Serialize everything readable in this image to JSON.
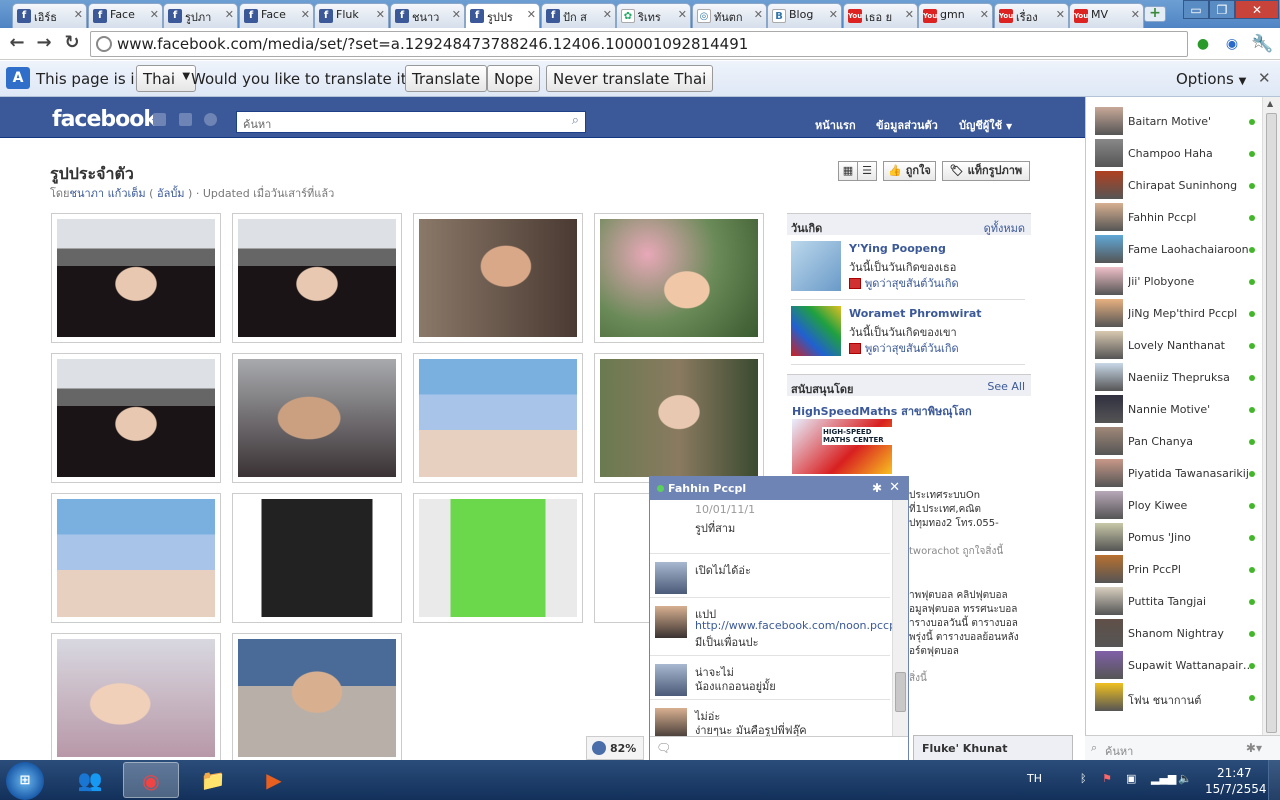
{
  "browser": {
    "tabs": [
      {
        "title": "เอิร์ธ",
        "icon": "f"
      },
      {
        "title": "Face",
        "icon": "f"
      },
      {
        "title": "รูปภา",
        "icon": "f"
      },
      {
        "title": "Face",
        "icon": "f"
      },
      {
        "title": "Fluk",
        "icon": "f"
      },
      {
        "title": "ชนาว",
        "icon": "f"
      },
      {
        "title": "รูปปร",
        "icon": "f",
        "active": true
      },
      {
        "title": "ปัก ส",
        "icon": "f"
      },
      {
        "title": "ริเทร",
        "icon": "g"
      },
      {
        "title": "ทันตก",
        "icon": "globe"
      },
      {
        "title": "Blog",
        "icon": "b"
      },
      {
        "title": "เธอ ย",
        "icon": "yt"
      },
      {
        "title": "gmn",
        "icon": "yt"
      },
      {
        "title": "เรื่อง",
        "icon": "yt"
      },
      {
        "title": "MV",
        "icon": "yt"
      }
    ],
    "new_tab": "+",
    "url": "www.facebook.com/media/set/?set=a.129248473788246.12406.100001092814491",
    "window_controls": {
      "minimize": "▭",
      "maximize": "❐",
      "close": "✕"
    }
  },
  "translate_bar": {
    "prefix": "This page is in",
    "language": "Thai",
    "question": "Would you like to translate it?",
    "translate": "Translate",
    "nope": "Nope",
    "never": "Never translate Thai",
    "options": "Options"
  },
  "fb": {
    "logo": "facebook",
    "search_placeholder": "ค้นหา",
    "nav_home": "หน้าแรก",
    "nav_profile": "ข้อมูลส่วนตัว",
    "nav_account": "บัญชีผู้ใช้"
  },
  "album": {
    "title": "รูปประจำตัว",
    "by": "โดย",
    "owner": "ชนาภา แก้วเต็ม",
    "album_link": "อัลบั้ม",
    "updated": "· Updated เมื่อวันเสาร์ที่แล้ว",
    "like": "ถูกใจ",
    "tag": "แท็กรูปภาพ"
  },
  "birthdays": {
    "header": "วันเกิด",
    "see_all": "ดูทั้งหมด",
    "items": [
      {
        "name": "Y'Ying Poopeng",
        "msg": "วันนี้เป็นวันเกิดของเธอ",
        "action": "พูดว่าสุขสันต์วันเกิด"
      },
      {
        "name": "Woramet Phromwirat",
        "msg": "วันนี้เป็นวันเกิดของเขา",
        "action": "พูดว่าสุขสันต์วันเกิด"
      }
    ]
  },
  "sponsored": {
    "header": "สนับสนุนโดย",
    "see_all": "See All",
    "title": "HighSpeedMaths สาขาพิษณุโลก",
    "img_label": "HIGH-SPEED MATHS CENTER",
    "text1": "ประเทศระบบOn",
    "text2": "ที่1ประเทศ,คณิต",
    "text3": "ปทุมทอง2 โทร.055-",
    "likes": "tworachot ถูกใจสิ่งนี้",
    "ad2_1": "าพฟุตบอล คลิปฟุตบอล",
    "ad2_2": "อมูลฟุตบอล ทรรศนะบอล",
    "ad2_3": "ารางบอลวันนี้ ตารางบอล",
    "ad2_4": "พรุ่งนี้ ตารางบอลย้อนหลัง",
    "ad2_5": "อร์ตฟุตบอล",
    "ad2_likes": "สิ่งนี้"
  },
  "zoom": "82%",
  "chat": {
    "name": "Fahhin Pccpl",
    "partial_top": "10/01/11/1",
    "messages": [
      {
        "lines": [
          "รูปที่สาม"
        ]
      },
      {
        "lines": [
          "เปิดไม่ได้อ่ะ"
        ]
      },
      {
        "lines": [
          "แปป",
          "http://www.facebook.com/noon.pccpl",
          "มีเป็นเพื่อนปะ"
        ]
      },
      {
        "lines": [
          "น่าจะไม่",
          "น้องแกออนอยู่มั้ย"
        ]
      },
      {
        "lines": [
          "ไม่อ่ะ",
          "ง่ายๆนะ มันคือรูปพี่ฟลุ๊ค"
        ]
      }
    ],
    "input_icon": "🗨",
    "second_tab": "Fluke' Khunat"
  },
  "buddies": [
    "Baitarn Motive'",
    "Champoo Haha",
    "Chirapat Suninhong",
    "Fahhin Pccpl",
    "Fame Laohachaiaroon",
    "Jii' Plobyone",
    "JiNg Mep'third Pccpl",
    "Lovely Nanthanat",
    "Naeniiz Thepruksa",
    "Nannie Motive'",
    "Pan Chanya",
    "Piyatida Tawanasarikij",
    "Ploy Kiwee",
    "Pomus 'Jino",
    "Prin PccPl",
    "Puttita Tangjai",
    "Shanom Nightray",
    "Supawit Wattanapair…",
    "โฟน ชนากานต์"
  ],
  "buddy_search": "ค้นหา",
  "taskbar": {
    "start": "⊞",
    "lang": "TH",
    "time": "21:47",
    "date": "15/7/2554"
  }
}
